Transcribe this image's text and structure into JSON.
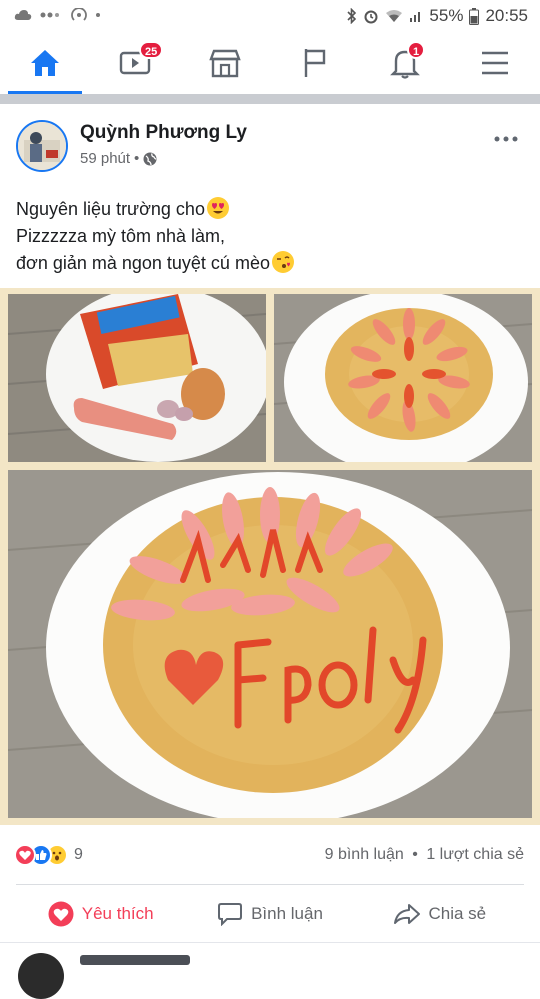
{
  "status_bar": {
    "battery": "55%",
    "time": "20:55"
  },
  "nav": {
    "tabs": [
      {
        "name": "home",
        "icon": "home-icon",
        "active": true
      },
      {
        "name": "watch",
        "icon": "video-icon",
        "badge": "25"
      },
      {
        "name": "marketplace",
        "icon": "store-icon"
      },
      {
        "name": "pages",
        "icon": "flag-icon"
      },
      {
        "name": "notifications",
        "icon": "bell-icon",
        "badge": "1"
      },
      {
        "name": "menu",
        "icon": "menu-icon"
      }
    ]
  },
  "post": {
    "author": "Quỳnh Phương Ly",
    "time": "59 phút",
    "privacy_icon": "globe-icon",
    "lines": [
      "Nguyên liệu trường cho",
      "Pizzzzza mỳ tôm nhà làm,",
      "đơn giản mà ngon tuyệt cú mèo"
    ],
    "line1_emoji": "heart-eyes-emoji",
    "line3_emoji": "kiss-emoji",
    "photos": [
      {
        "name": "ingredients-photo"
      },
      {
        "name": "pizza-top-photo"
      },
      {
        "name": "pizza-fpoly-photo"
      }
    ],
    "reaction_count": "9",
    "comments": "9 bình luận",
    "shares": "1 lượt chia sẻ",
    "separator": "•"
  },
  "actions": {
    "like": "Yêu thích",
    "comment": "Bình luận",
    "share": "Chia sẻ"
  },
  "colors": {
    "accent": "#1877f2",
    "love": "#f33e58",
    "badge": "#e41e3f"
  }
}
